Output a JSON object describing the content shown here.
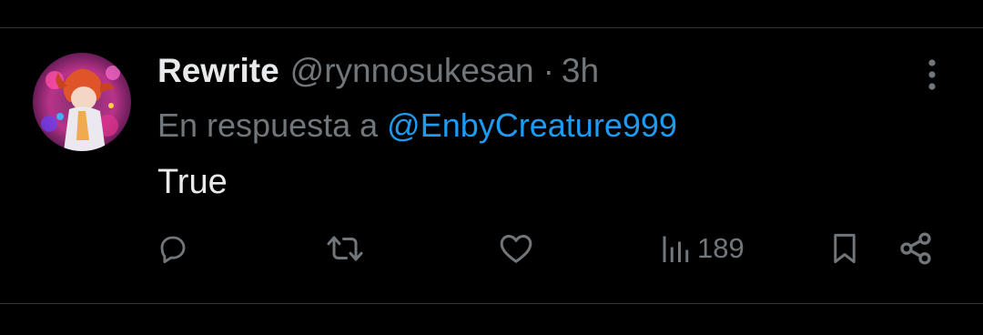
{
  "tweet": {
    "display_name": "Rewrite",
    "handle": "@rynnosukesan",
    "separator": "·",
    "time": "3h",
    "reply_prefix": "En respuesta a",
    "reply_mention": "@EnbyCreature999",
    "text": "True",
    "views": "189"
  },
  "icons": {
    "more": "more-vertical-icon",
    "reply": "reply-icon",
    "retweet": "retweet-icon",
    "like": "heart-icon",
    "views": "views-bar-chart-icon",
    "bookmark": "bookmark-icon",
    "share": "share-icon"
  },
  "colors": {
    "background": "#000000",
    "text_primary": "#e7e9ea",
    "text_secondary": "#71767b",
    "link": "#1d9bf0",
    "divider": "#2f3336"
  }
}
